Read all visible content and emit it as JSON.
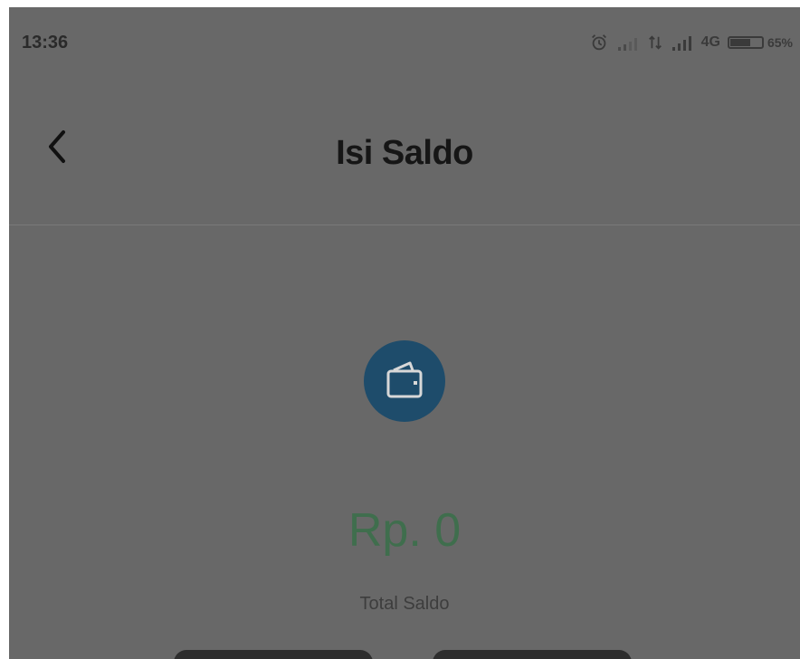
{
  "status_bar": {
    "time": "13:36",
    "network": "4G",
    "battery_percent": "65%",
    "battery_level": 0.65
  },
  "header": {
    "title": "Isi Saldo"
  },
  "balance": {
    "amount": "Rp. 0",
    "label": "Total Saldo"
  },
  "colors": {
    "background": "#686868",
    "wallet_icon_bg": "#1e4c6b",
    "amount_text": "#3f6e4d"
  },
  "icons": {
    "back": "chevron-left-icon",
    "wallet": "wallet-icon",
    "alarm": "alarm-icon",
    "signal": "signal-icon"
  }
}
